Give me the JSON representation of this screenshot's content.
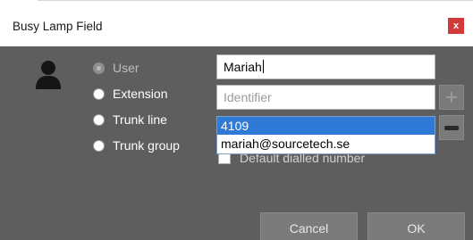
{
  "dialog": {
    "title": "Busy Lamp Field",
    "close_label": "x"
  },
  "type_options": [
    {
      "label": "User",
      "checked": true,
      "disabled": true
    },
    {
      "label": "Extension",
      "checked": false,
      "disabled": false
    },
    {
      "label": "Trunk line",
      "checked": false,
      "disabled": false
    },
    {
      "label": "Trunk group",
      "checked": false,
      "disabled": false
    }
  ],
  "name_input": {
    "value": "Mariah"
  },
  "identifier_input": {
    "value": "",
    "placeholder": "Identifier"
  },
  "autocomplete": {
    "items": [
      "4109",
      "mariah@sourcetech.se"
    ],
    "selected_index": 0
  },
  "default_dialed": {
    "label": "Default dialled number",
    "checked": false
  },
  "buttons": {
    "cancel": "Cancel",
    "ok": "OK"
  },
  "colors": {
    "panel": "#5e5e5e",
    "close": "#d23a3a",
    "selection": "#2f7ad6"
  },
  "icons": {
    "user": "user-icon",
    "add": "plus-icon",
    "remove": "minus-icon"
  }
}
